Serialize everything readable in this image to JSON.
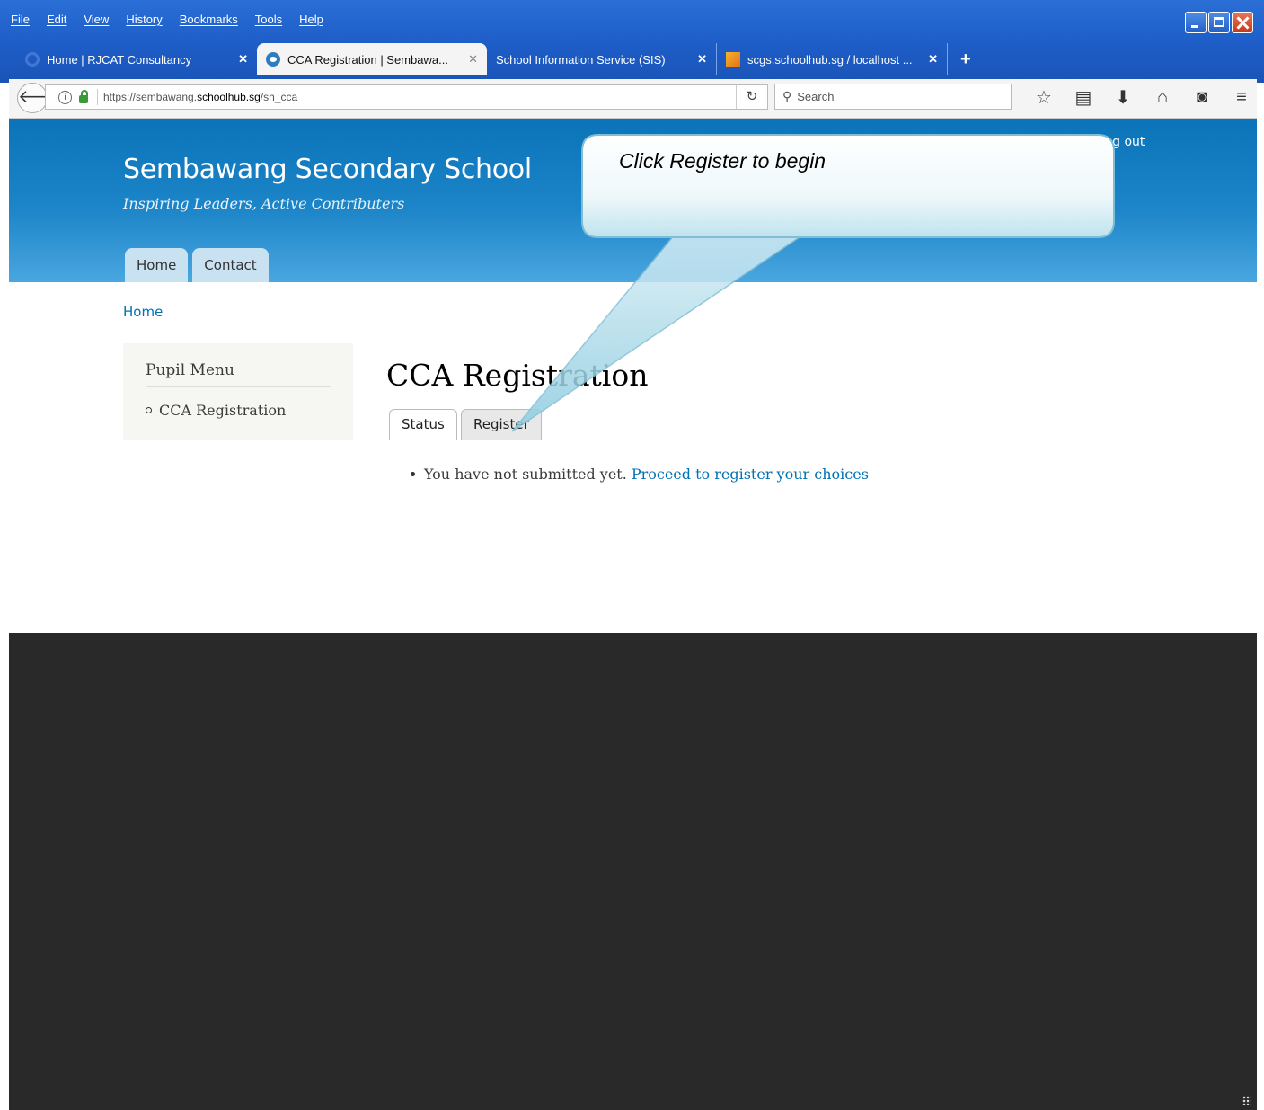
{
  "browser": {
    "menu": [
      "File",
      "Edit",
      "View",
      "History",
      "Bookmarks",
      "Tools",
      "Help"
    ],
    "tabs": [
      {
        "label": "Home | RJCAT Consultancy",
        "close": "✕"
      },
      {
        "label": "CCA Registration | Sembawa...",
        "close": "✕"
      },
      {
        "label": "School Information Service (SIS)",
        "close": "✕"
      },
      {
        "label": "scgs.schoolhub.sg / localhost ...",
        "close": "✕"
      }
    ],
    "new_tab": "+",
    "url_prefix": "https://sembawang.",
    "url_host": "schoolhub.sg",
    "url_path": "/sh_cca",
    "search_placeholder": "Search"
  },
  "site": {
    "name": "Sembawang Secondary School",
    "slogan": "Inspiring Leaders, Active Contributers",
    "logout": "Log out",
    "nav": [
      "Home",
      "Contact"
    ]
  },
  "breadcrumb": "Home",
  "sidebar": {
    "title": "Pupil Menu",
    "items": [
      "CCA Registration"
    ]
  },
  "main": {
    "title": "CCA Registration",
    "tabs": [
      "Status",
      "Register"
    ],
    "status_text": "You have not submitted yet.",
    "status_link": "Proceed to register your choices"
  },
  "callout": {
    "text": "Click Register to begin"
  },
  "colors": {
    "header_blue": "#0b73b8",
    "link": "#0071b3",
    "footer": "#292929"
  }
}
